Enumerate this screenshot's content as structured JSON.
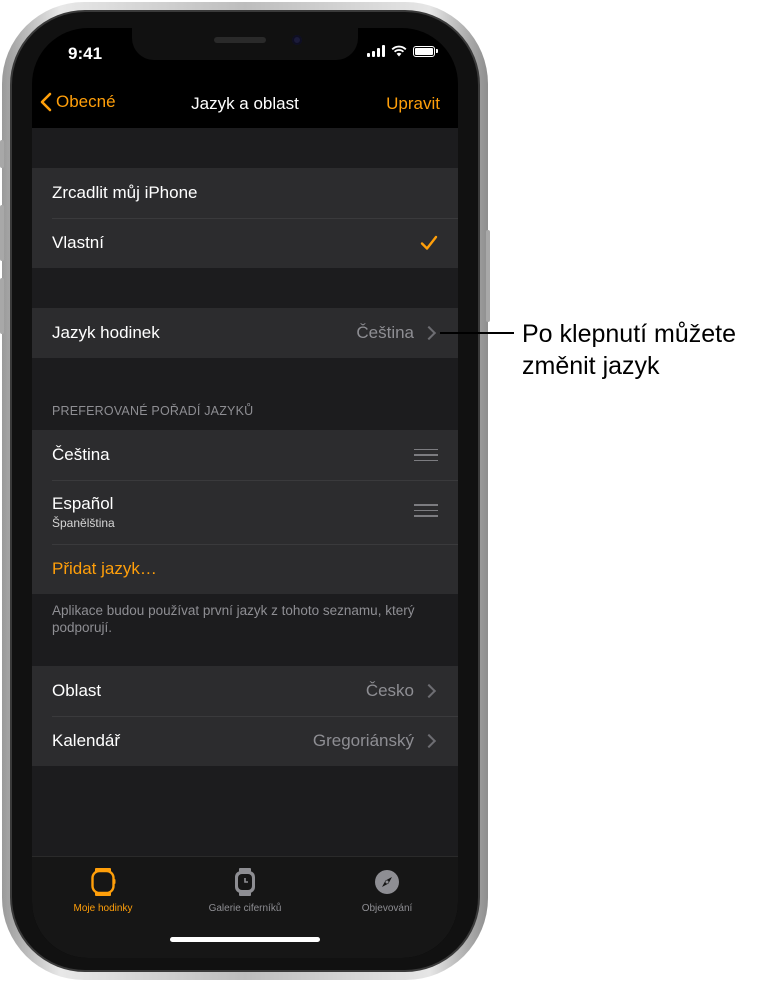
{
  "status_bar": {
    "time": "9:41"
  },
  "nav": {
    "back_label": "Obecné",
    "title": "Jazyk a oblast",
    "action_label": "Upravit"
  },
  "mirror_group": [
    {
      "label": "Zrcadlit můj iPhone",
      "checked": false
    },
    {
      "label": "Vlastní",
      "checked": true
    }
  ],
  "watch_language": {
    "label": "Jazyk hodinek",
    "value": "Čeština"
  },
  "preferred_languages": {
    "header": "PREFEROVANÉ POŘADÍ JAZYKŮ",
    "items": [
      {
        "label": "Čeština",
        "sublabel": ""
      },
      {
        "label": "Español",
        "sublabel": "Španělština"
      }
    ],
    "add_label": "Přidat jazyk…",
    "footer": "Aplikace budou používat první jazyk z tohoto seznamu, který podporují."
  },
  "region_group": [
    {
      "label": "Oblast",
      "value": "Česko"
    },
    {
      "label": "Kalendář",
      "value": "Gregoriánský"
    }
  ],
  "tabs": [
    {
      "label": "Moje hodinky",
      "icon": "watch-icon",
      "active": true
    },
    {
      "label": "Galerie ciferníků",
      "icon": "watch-face-icon",
      "active": false
    },
    {
      "label": "Objevování",
      "icon": "compass-icon",
      "active": false
    }
  ],
  "callout": {
    "text": "Po klepnutí můžete změnit jazyk"
  },
  "colors": {
    "accent": "#ff9f0a",
    "background": "#1c1c1e",
    "cell": "#2c2c2e"
  }
}
